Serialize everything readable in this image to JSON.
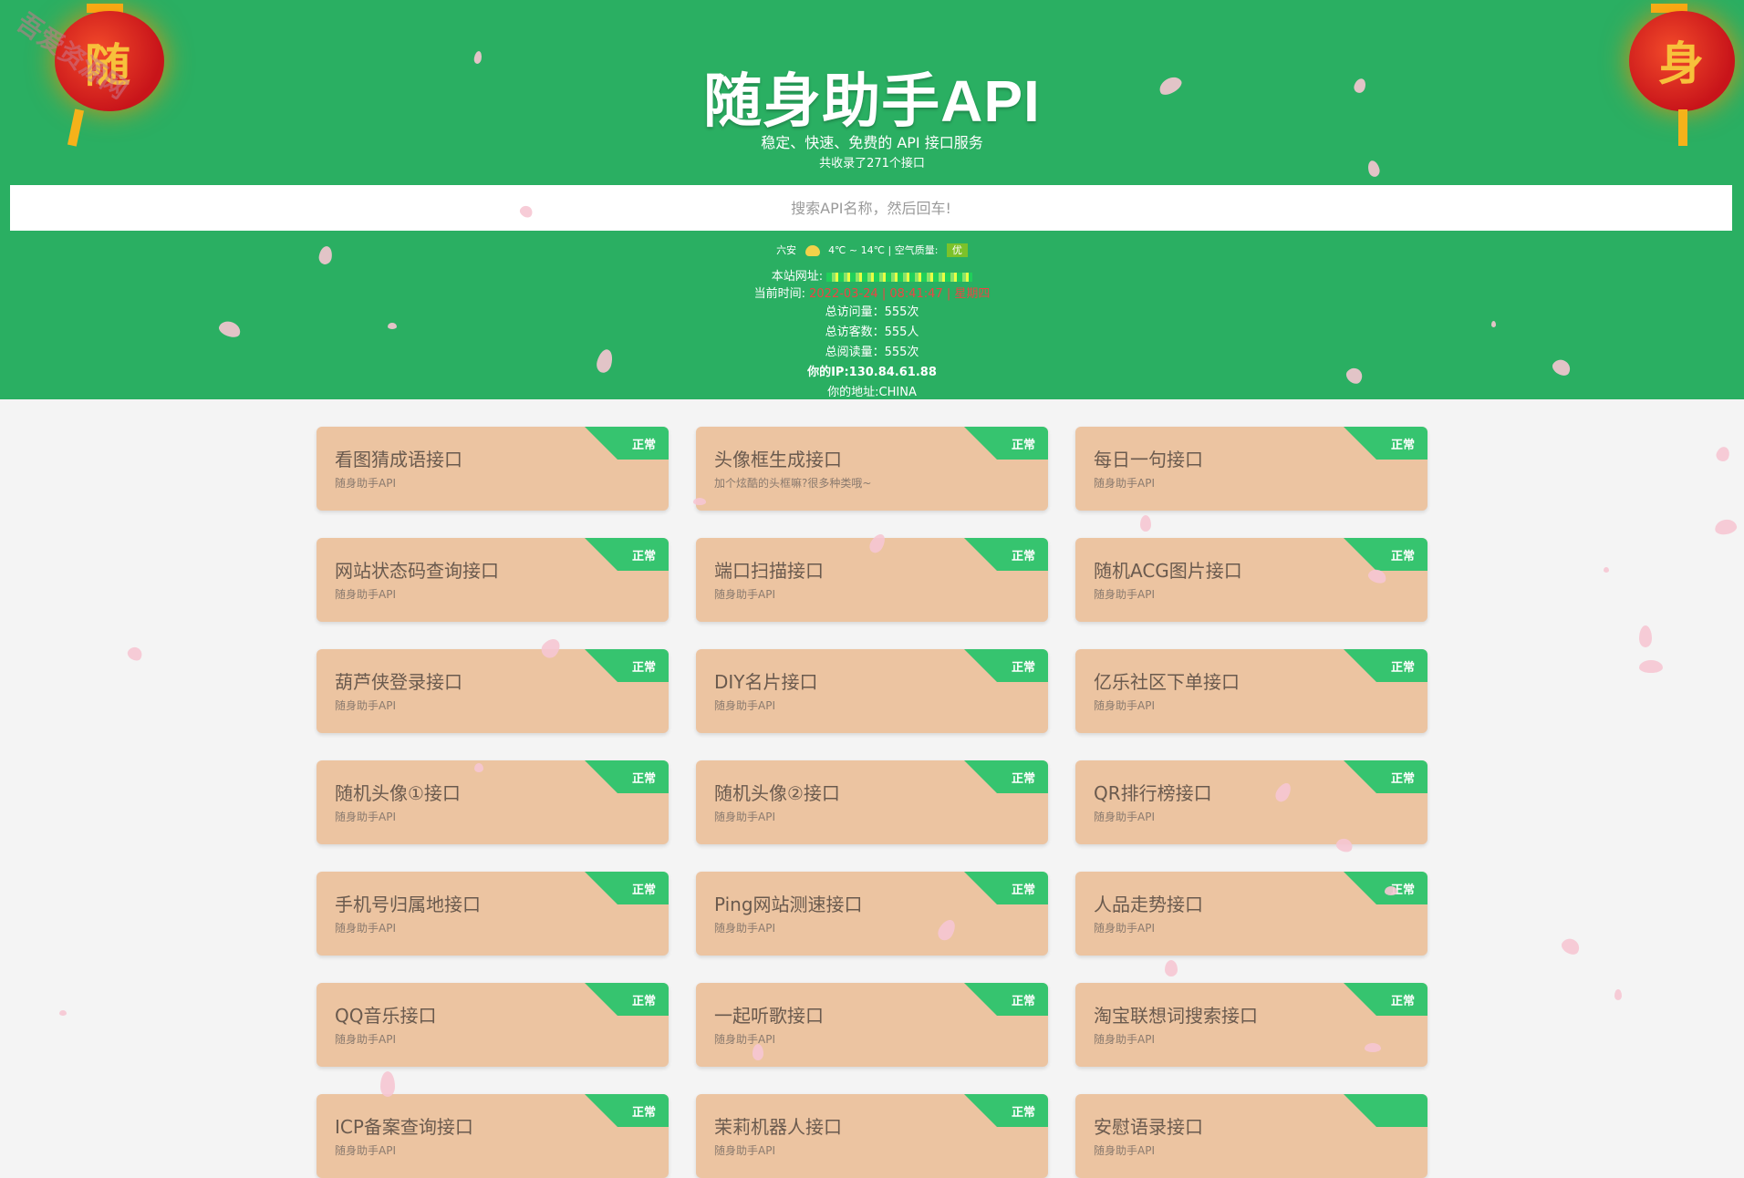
{
  "header": {
    "title": "随身助手API",
    "subtitle": "稳定、快速、免费的 API 接口服务",
    "count_text": "共收录了271个接口"
  },
  "search": {
    "placeholder": "搜索API名称，然后回车!"
  },
  "weather": {
    "city": "六安",
    "temp": "4℃ ~ 14℃",
    "separator": "|",
    "aq_label": "空气质量:",
    "aq_value": "优"
  },
  "stats": {
    "site_label": "本站网址:",
    "time_label": "当前时间:",
    "time_value": "2022-03-24 | 08:41:47 | 星期四",
    "visits": "总访问量：555次",
    "visitors": "总访客数：555人",
    "reads": "总阅读量：555次",
    "ip": "你的IP:130.84.61.88",
    "location": "你的地址:CHINA"
  },
  "lanterns": {
    "left_char": "随",
    "right_char": "身"
  },
  "watermark": "吾爱资源网",
  "accent_colors": {
    "header_bg": "#2aaf62",
    "card_bg": "#ecc4a1",
    "status_bg": "#36c46f"
  },
  "cards": [
    {
      "name": "看图猜成语接口",
      "desc": "随身助手API",
      "status": "正常"
    },
    {
      "name": "头像框生成接口",
      "desc": "加个炫酷的头框嘛?很多种类哦~",
      "status": "正常"
    },
    {
      "name": "每日一句接口",
      "desc": "随身助手API",
      "status": "正常"
    },
    {
      "name": "网站状态码查询接口",
      "desc": "随身助手API",
      "status": "正常"
    },
    {
      "name": "端口扫描接口",
      "desc": "随身助手API",
      "status": "正常"
    },
    {
      "name": "随机ACG图片接口",
      "desc": "随身助手API",
      "status": "正常"
    },
    {
      "name": "葫芦侠登录接口",
      "desc": "随身助手API",
      "status": "正常"
    },
    {
      "name": "DIY名片接口",
      "desc": "随身助手API",
      "status": "正常"
    },
    {
      "name": "亿乐社区下单接口",
      "desc": "随身助手API",
      "status": "正常"
    },
    {
      "name": "随机头像①接口",
      "desc": "随身助手API",
      "status": "正常"
    },
    {
      "name": "随机头像②接口",
      "desc": "随身助手API",
      "status": "正常"
    },
    {
      "name": "QR排行榜接口",
      "desc": "随身助手API",
      "status": "正常"
    },
    {
      "name": "手机号归属地接口",
      "desc": "随身助手API",
      "status": "正常"
    },
    {
      "name": "Ping网站测速接口",
      "desc": "随身助手API",
      "status": "正常"
    },
    {
      "name": "人品走势接口",
      "desc": "随身助手API",
      "status": "正常"
    },
    {
      "name": "QQ音乐接口",
      "desc": "随身助手API",
      "status": "正常"
    },
    {
      "name": "一起听歌接口",
      "desc": "随身助手API",
      "status": "正常"
    },
    {
      "name": "淘宝联想词搜索接口",
      "desc": "随身助手API",
      "status": "正常"
    },
    {
      "name": "ICP备案查询接口",
      "desc": "随身助手API",
      "status": "正常"
    },
    {
      "name": "茉莉机器人接口",
      "desc": "随身助手API",
      "status": "正常"
    },
    {
      "name": "安慰语录接口",
      "desc": "随身助手API",
      "status": ""
    }
  ]
}
